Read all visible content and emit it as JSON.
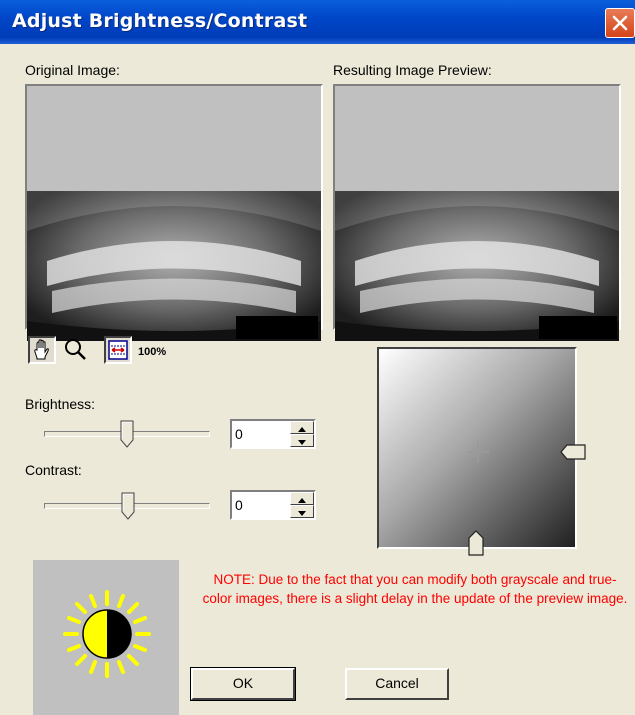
{
  "window": {
    "title": "Adjust Brightness/Contrast"
  },
  "labels": {
    "original": "Original Image:",
    "preview": "Resulting Image Preview:",
    "brightness": "Brightness:",
    "contrast": "Contrast:"
  },
  "toolbar": [
    {
      "name": "hand-tool",
      "icon": "hand-icon"
    },
    {
      "name": "zoom-tool",
      "icon": "magnifier-icon"
    },
    {
      "name": "fit-tool",
      "icon": "fit-width-icon"
    },
    {
      "name": "actual-size-tool",
      "icon": "100-percent-icon",
      "label": "100%"
    }
  ],
  "brightness": {
    "value": "0",
    "level": 0
  },
  "contrast": {
    "value": "0",
    "level": 0
  },
  "note": "NOTE: Due to the fact that you can modify both grayscale and true-color images, there is a slight delay in the update of the preview image.",
  "buttons": {
    "ok": "OK",
    "cancel": "Cancel"
  },
  "colors": {
    "title_bar": "#0047c8",
    "note_text": "#ff0000",
    "sun": "#ffff00"
  }
}
